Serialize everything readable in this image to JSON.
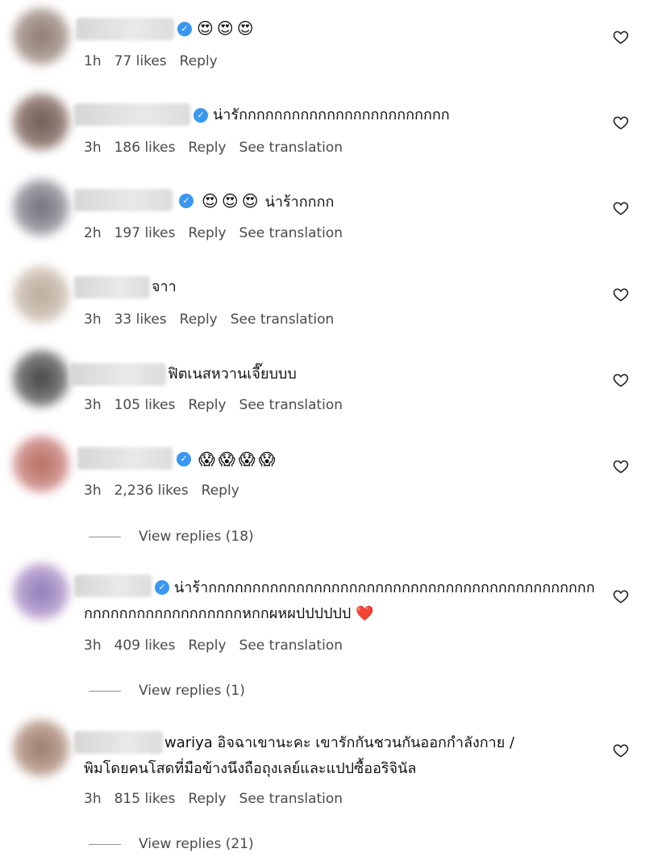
{
  "comments": [
    {
      "text": "",
      "emojis": [
        "😍",
        "😍",
        "😍"
      ],
      "time": "1h",
      "likes": "77 likes",
      "reply": "Reply",
      "translate": ""
    },
    {
      "text": "น่ารักกกกกกกกกกกกกกกกกกกกกกกก",
      "emojis": [],
      "time": "3h",
      "likes": "186 likes",
      "reply": "Reply",
      "translate": "See translation"
    },
    {
      "text": "น่าร้ากกกก",
      "emojis": [
        "😍",
        "😍",
        "😍"
      ],
      "time": "2h",
      "likes": "197 likes",
      "reply": "Reply",
      "translate": "See translation"
    },
    {
      "text": "จาา",
      "emojis": [],
      "time": "3h",
      "likes": "33 likes",
      "reply": "Reply",
      "translate": "See translation"
    },
    {
      "text": "ฟิตเนสหวานเจี๊ยบบบ",
      "emojis": [],
      "time": "3h",
      "likes": "105 likes",
      "reply": "Reply",
      "translate": "See translation"
    },
    {
      "text": "",
      "emojis": [
        "😱",
        "😱",
        "😱",
        "😱"
      ],
      "time": "3h",
      "likes": "2,236 likes",
      "reply": "Reply",
      "translate": "",
      "view_replies": "View replies (18)"
    },
    {
      "text": "น่าร้ากกกกกกกกกกกกกกกกกกกกกกกกกกกกกกกกกกกกกกกกกกกก",
      "text2": "กกกกกกกกกกกกกกกกกกหกกผหผปปปปปป",
      "heart_emoji": "❤️",
      "emojis": [],
      "time": "3h",
      "likes": "409 likes",
      "reply": "Reply",
      "translate": "See translation",
      "view_replies": "View replies (1)"
    },
    {
      "text": "wariya อิจฉาเขานะคะ เขารักกันชวนกันออกกำลังกาย /",
      "text2": "พิมโดยคนโสดที่มือข้างนึงถือถุงเลย์และแปปซื้ออริจินัล",
      "emojis": [],
      "time": "3h",
      "likes": "815 likes",
      "reply": "Reply",
      "translate": "See translation",
      "view_replies": "View replies (21)"
    }
  ]
}
